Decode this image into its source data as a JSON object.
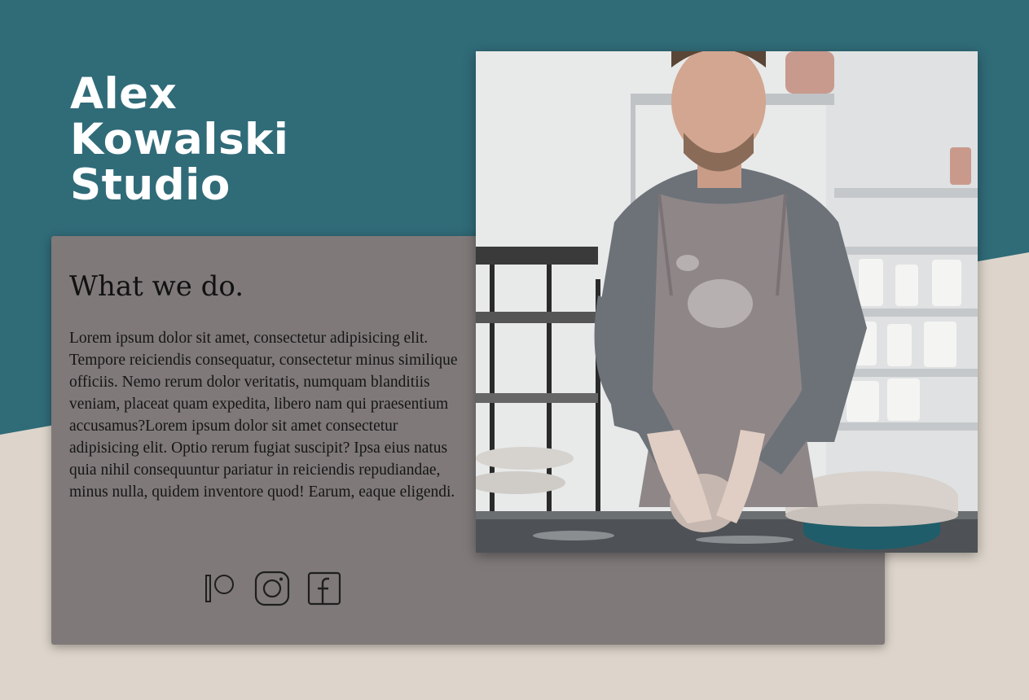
{
  "hero": {
    "title_lines": [
      "Alex",
      "Kowalski",
      "Studio"
    ]
  },
  "card": {
    "heading": "What we do.",
    "body": "Lorem ipsum dolor sit amet, consectetur adipisicing elit. Tempore reiciendis consequatur, consectetur minus similique officiis. Nemo rerum dolor veritatis, numquam blanditiis veniam, placeat quam expedita, libero nam qui praesentium accusamus?Lorem ipsum dolor sit amet consectetur adipisicing elit. Optio rerum fugiat suscipit? Ipsa eius natus quia nihil consequuntur pariatur in reiciendis repudiandae, minus nulla, quidem inventore quod! Earum, eaque eligendi."
  },
  "social": {
    "icons": [
      "patreon-icon",
      "instagram-icon",
      "facebook-icon"
    ]
  },
  "photo": {
    "subject": "potter-shaping-clay-photo"
  },
  "colors": {
    "teal_background": "#306b78",
    "beige_background": "#ddd5cb",
    "card_background": "#7f7979",
    "title_text": "#ffffff"
  }
}
